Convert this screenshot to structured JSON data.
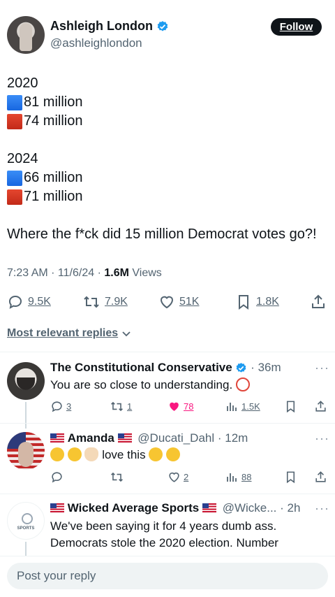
{
  "author": {
    "name": "Ashleigh London",
    "handle": "@ashleighlondon",
    "follow_label": "Follow"
  },
  "post": {
    "year1": "2020",
    "y1_blue": "81 million",
    "y1_red": "74 million",
    "year2": "2024",
    "y2_blue": "66 million",
    "y2_red": "71 million",
    "question": "Where the f*ck did 15 million Democrat votes go?!",
    "time": "7:23 AM",
    "date": "11/6/24",
    "views_count": "1.6M",
    "views_label": "Views"
  },
  "actions": {
    "replies": "9.5K",
    "reposts": "7.9K",
    "likes": "51K",
    "bookmarks": "1.8K"
  },
  "replies_filter": "Most relevant replies",
  "replies": [
    {
      "name": "The Constitutional Conservative",
      "handle": "",
      "time": "36m",
      "text": "You are so close to understanding.",
      "replies": "3",
      "reposts": "1",
      "likes": "78",
      "views": "1.5K"
    },
    {
      "name": "Amanda",
      "handle": "@Ducati_Dahl",
      "time": "12m",
      "text": "love this",
      "replies": "",
      "reposts": "",
      "likes": "2",
      "views": "88"
    },
    {
      "name": "Wicked Average Sports",
      "handle": "@Wicke...",
      "time": "2h",
      "text": "We've been saying it for 4 years dumb ass. Democrats stole the 2020 election. Number",
      "avatar_text": "SPORTS"
    }
  ],
  "composer": {
    "placeholder": "Post your reply"
  },
  "colors": {
    "accent": "#1d9bf0",
    "like_active": "#f91880",
    "text": "#0f1419",
    "muted": "#536471"
  }
}
